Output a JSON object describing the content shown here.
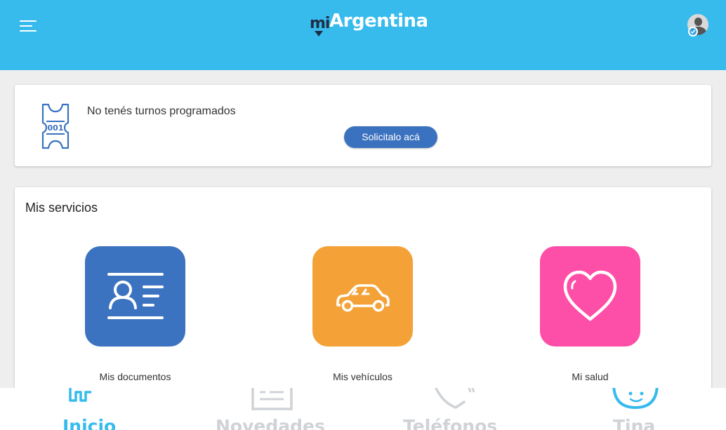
{
  "header": {
    "logo_mi": "mi",
    "logo_argentina": "Argentina",
    "colors": {
      "background": "#37bbed",
      "logo_dark": "#1d2f45"
    }
  },
  "turnos": {
    "message": "No tenés turnos programados",
    "button_label": "Solicitalo acá"
  },
  "servicios": {
    "title": "Mis servicios",
    "items": [
      {
        "label": "Mis documentos",
        "icon": "id-card-icon",
        "color": "#3b73c0"
      },
      {
        "label": "Mis vehículos",
        "icon": "car-icon",
        "color": "#f4a238"
      },
      {
        "label": "Mi salud",
        "icon": "heart-icon",
        "color": "#fd4fa7"
      }
    ]
  },
  "bottom_nav": {
    "items": [
      {
        "label": "Inicio",
        "icon": "home-icon",
        "active": true
      },
      {
        "label": "Novedades",
        "icon": "news-icon",
        "active": false
      },
      {
        "label": "Teléfonos",
        "icon": "phone-icon",
        "active": false
      },
      {
        "label": "Tina",
        "icon": "tina-bot-icon",
        "active": false
      }
    ],
    "colors": {
      "active": "#37bbed",
      "inactive": "#cfd3d7"
    }
  }
}
